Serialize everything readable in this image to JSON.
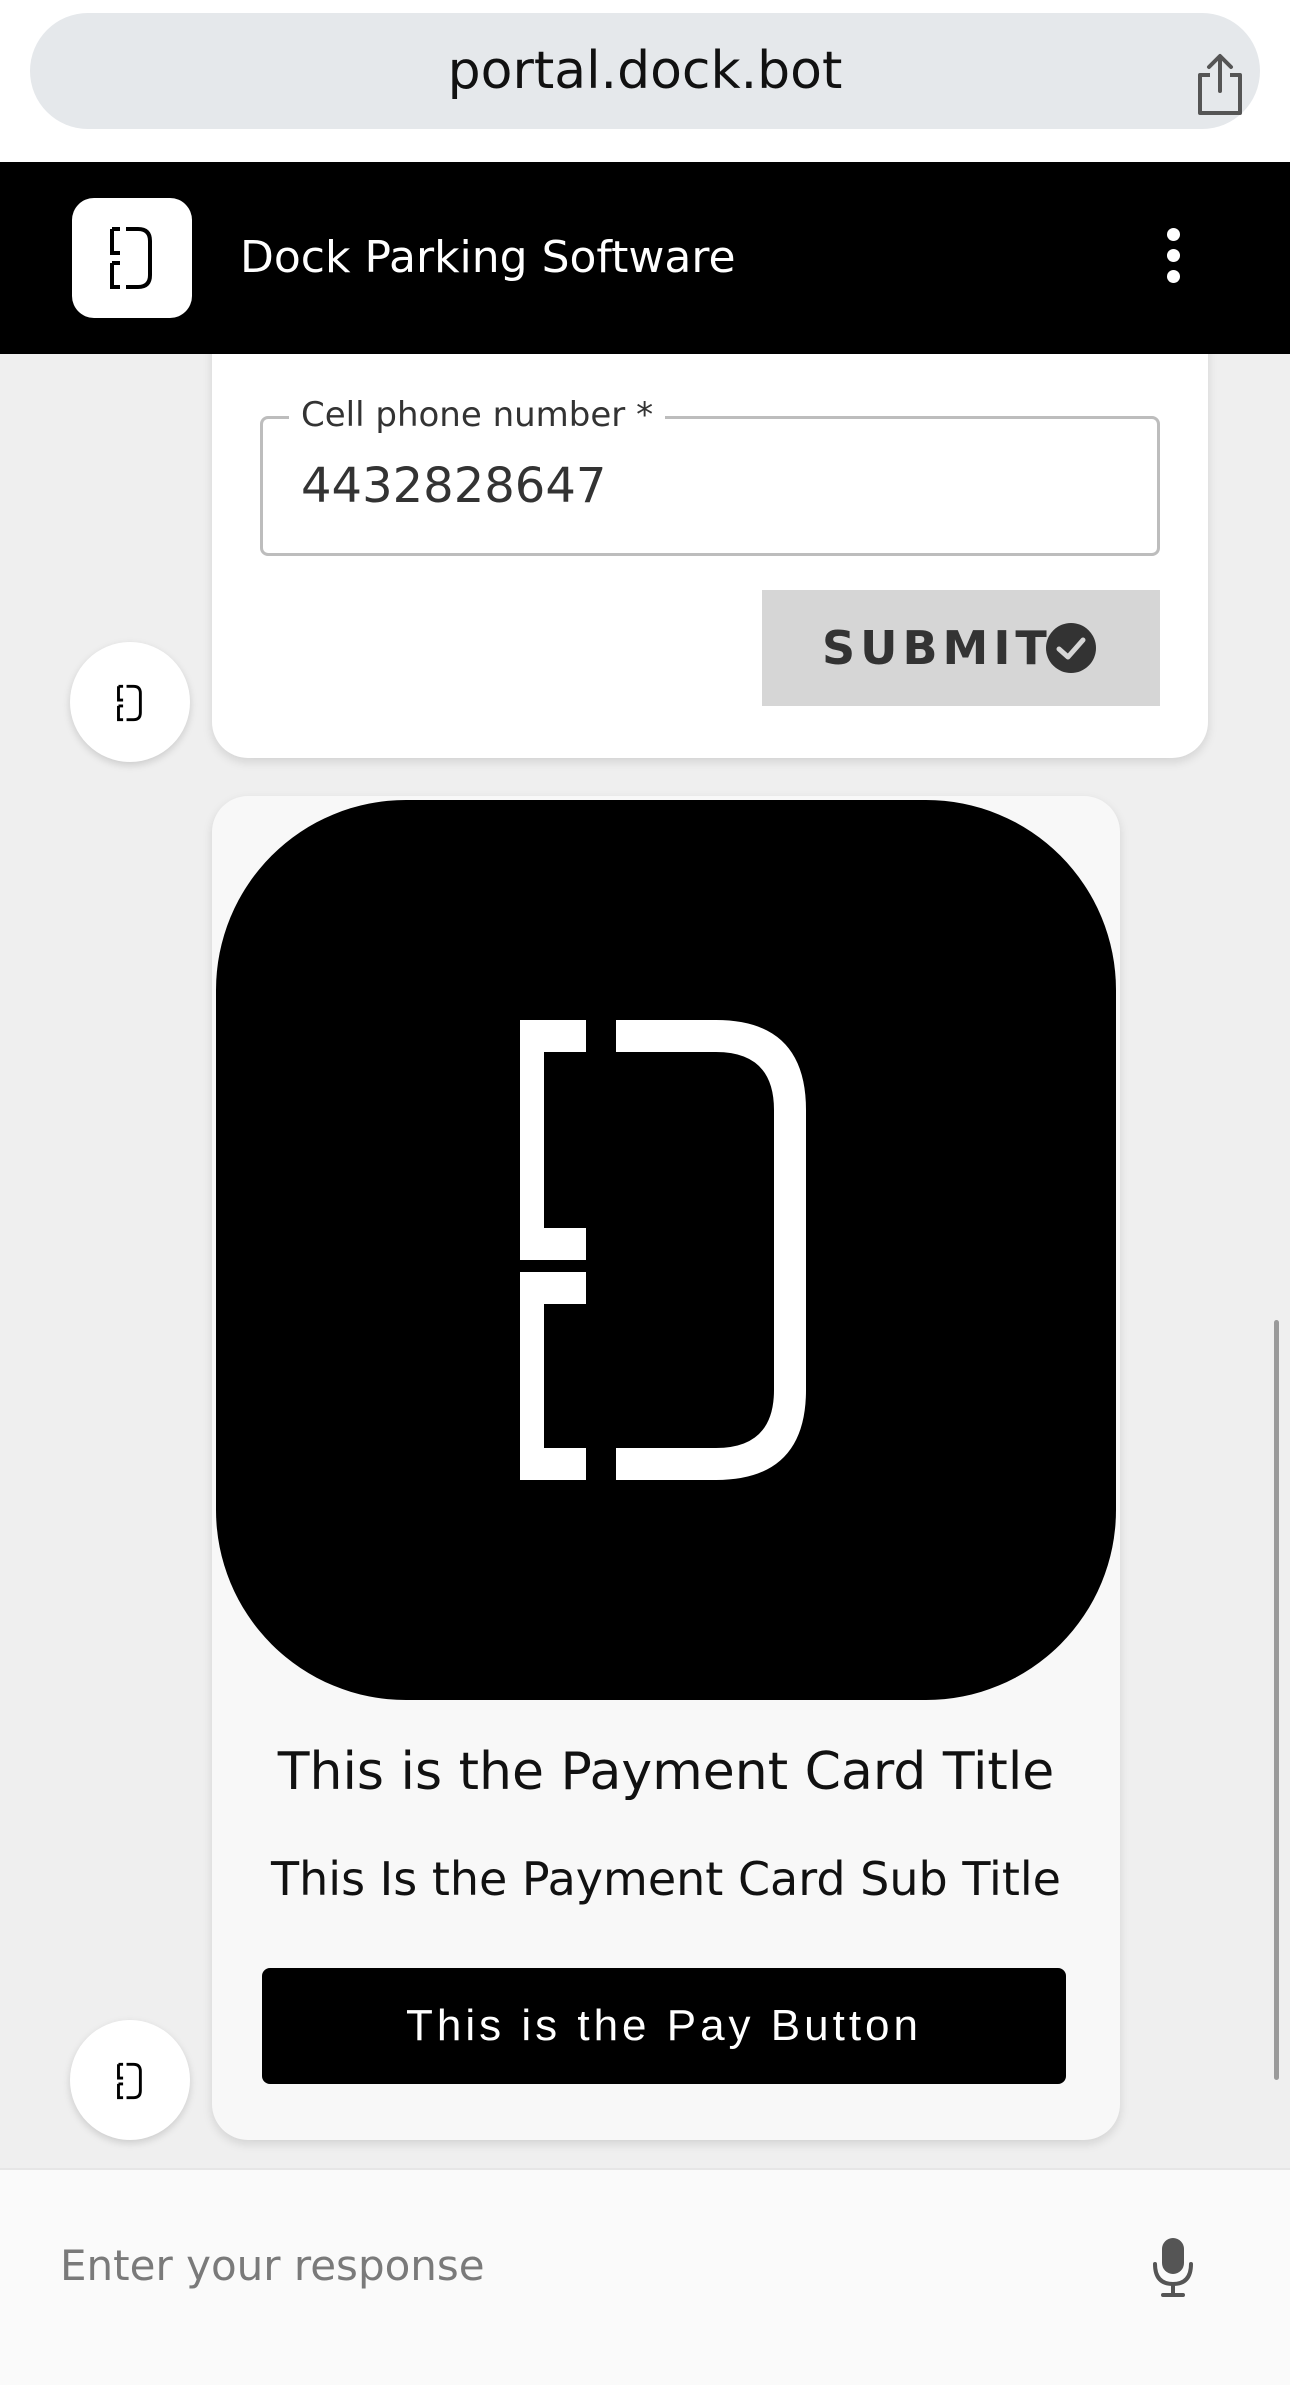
{
  "browser": {
    "url": "portal.dock.bot",
    "share_icon": "share-icon"
  },
  "header": {
    "logo_icon": "dock-logo-icon",
    "title": "Dock Parking Software",
    "menu_icon": "more-vertical-icon"
  },
  "form_card": {
    "phone_label": "Cell phone number *",
    "phone_value": "4432828647",
    "submit_label": "SUBMIT",
    "submit_icon": "check-circle-icon"
  },
  "payment_card": {
    "image_icon": "dock-logo-icon",
    "title": "This is the Payment Card Title",
    "subtitle": "This Is the Payment Card Sub Title",
    "button_label": "This is the Pay Button"
  },
  "input": {
    "placeholder": "Enter your response",
    "mic_icon": "microphone-icon"
  },
  "colors": {
    "header_bg": "#000000",
    "chat_bg": "#efefef",
    "submit_bg": "#d6d6d6",
    "pay_button_bg": "#000000"
  }
}
